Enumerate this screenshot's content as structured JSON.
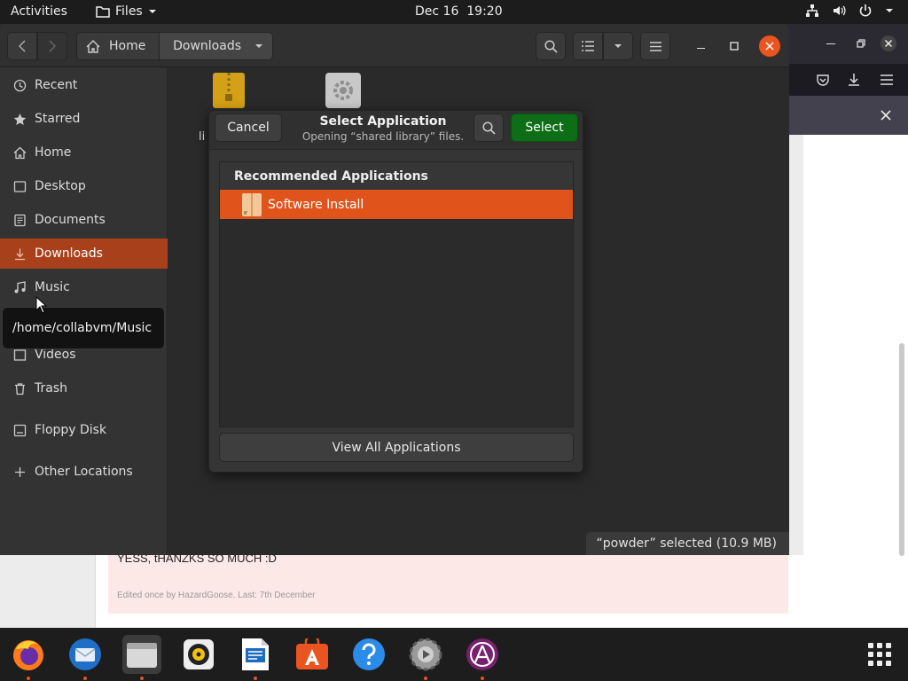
{
  "topbar": {
    "activities": "Activities",
    "app_name": "Files",
    "date": "Dec 16",
    "time": "19:20"
  },
  "headerbar": {
    "path_home": "Home",
    "path_current": "Downloads"
  },
  "sidebar": {
    "items": [
      {
        "label": "Recent",
        "icon": "clock-icon"
      },
      {
        "label": "Starred",
        "icon": "star-icon"
      },
      {
        "label": "Home",
        "icon": "home-icon"
      },
      {
        "label": "Desktop",
        "icon": "desktop-icon"
      },
      {
        "label": "Documents",
        "icon": "document-icon"
      },
      {
        "label": "Downloads",
        "icon": "download-icon",
        "active": true
      },
      {
        "label": "Music",
        "icon": "music-icon"
      },
      {
        "label": "Videos",
        "icon": "video-icon"
      },
      {
        "label": "Trash",
        "icon": "trash-icon"
      },
      {
        "label": "Floppy Disk",
        "icon": "drive-icon"
      },
      {
        "label": "Other Locations",
        "icon": "plus-icon"
      }
    ]
  },
  "tooltip": "/home/collabvm/Music",
  "content": {
    "file_partial_label": "li",
    "status": "“powder” selected  (10.9 MB)"
  },
  "dialog": {
    "cancel": "Cancel",
    "title": "Select Application",
    "subtitle": "Opening “shared library” files.",
    "select": "Select",
    "list_header": "Recommended Applications",
    "apps": [
      "Software Install"
    ],
    "view_all": "View All Applications"
  },
  "page_behind": {
    "message": "YESS, tHANZKS SO MUCH :D",
    "edited": "Edited once by HazardGoose. Last: 7th December"
  },
  "dock": {
    "items": [
      "firefox-icon",
      "thunderbird-icon",
      "files-icon",
      "rhythmbox-icon",
      "writer-icon",
      "software-center-icon",
      "help-icon",
      "settings-icon",
      "ubuntu-advantage-icon",
      "show-apps-icon"
    ]
  },
  "colors": {
    "accent": "#e95420",
    "select_green": "#0e6e17"
  }
}
